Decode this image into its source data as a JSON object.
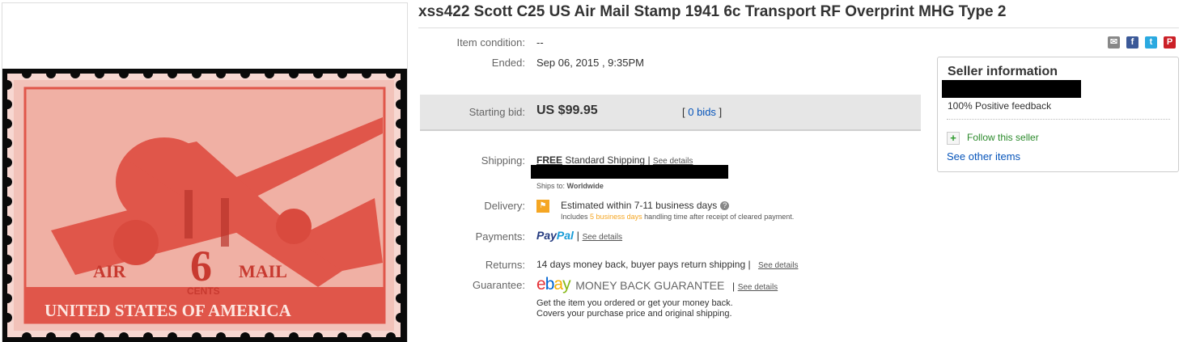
{
  "title": "xss422 Scott C25 US Air Mail Stamp 1941 6c Transport RF Overprint MHG Type 2",
  "stamp": {
    "line1_left": "AIR",
    "denomination": "6",
    "line1_right": "MAIL",
    "cents": "CENTS",
    "country": "UNITED STATES OF AMERICA"
  },
  "item_condition": {
    "label": "Item condition:",
    "value": "--"
  },
  "ended": {
    "label": "Ended:",
    "value": "Sep 06, 2015 , 9:35PM"
  },
  "bid": {
    "label": "Starting bid:",
    "price": "US $99.95",
    "bids_open": "[ ",
    "bids_link": "0 bids",
    "bids_close": " ]"
  },
  "shipping": {
    "label": "Shipping:",
    "free": "FREE",
    "method": "Standard Shipping",
    "sep": "|",
    "see_details": "See details",
    "ships_to_label": "Ships to:",
    "ships_to_value": "Worldwide"
  },
  "delivery": {
    "label": "Delivery:",
    "estimate": "Estimated within 7-11 business days",
    "q": "?",
    "includes_pre": "Includes",
    "includes_days": "5 business days",
    "includes_post": "handling time after receipt of cleared payment."
  },
  "payments": {
    "label": "Payments:",
    "paypal_pay": "Pay",
    "paypal_pal": "Pal",
    "sep": "|",
    "see_details": "See details"
  },
  "returns": {
    "label": "Returns:",
    "value": "14 days money back, buyer pays return shipping",
    "sep": "|",
    "see_details": "See details"
  },
  "guarantee": {
    "label": "Guarantee:",
    "ebay_e": "e",
    "ebay_b": "b",
    "ebay_a": "a",
    "ebay_y": "y",
    "mbg": "MONEY BACK GUARANTEE",
    "sep": "|",
    "see_details": "See details",
    "line1": "Get the item you ordered or get your money back.",
    "line2": "Covers your purchase price and original shipping."
  },
  "share_icons": [
    "email-icon",
    "facebook-icon",
    "twitter-icon",
    "pinterest-icon"
  ],
  "seller": {
    "title": "Seller information",
    "feedback": "100% Positive feedback",
    "follow": "Follow this seller",
    "plus": "+",
    "other": "See other items"
  },
  "colors": {
    "link": "#0654ba",
    "ebay_e": "#e53238",
    "ebay_b": "#0064d2",
    "ebay_a": "#f5af02",
    "ebay_y": "#86b817",
    "paypal_dark": "#253b80",
    "paypal_light": "#179bd7",
    "stamp": "#e0564a"
  }
}
